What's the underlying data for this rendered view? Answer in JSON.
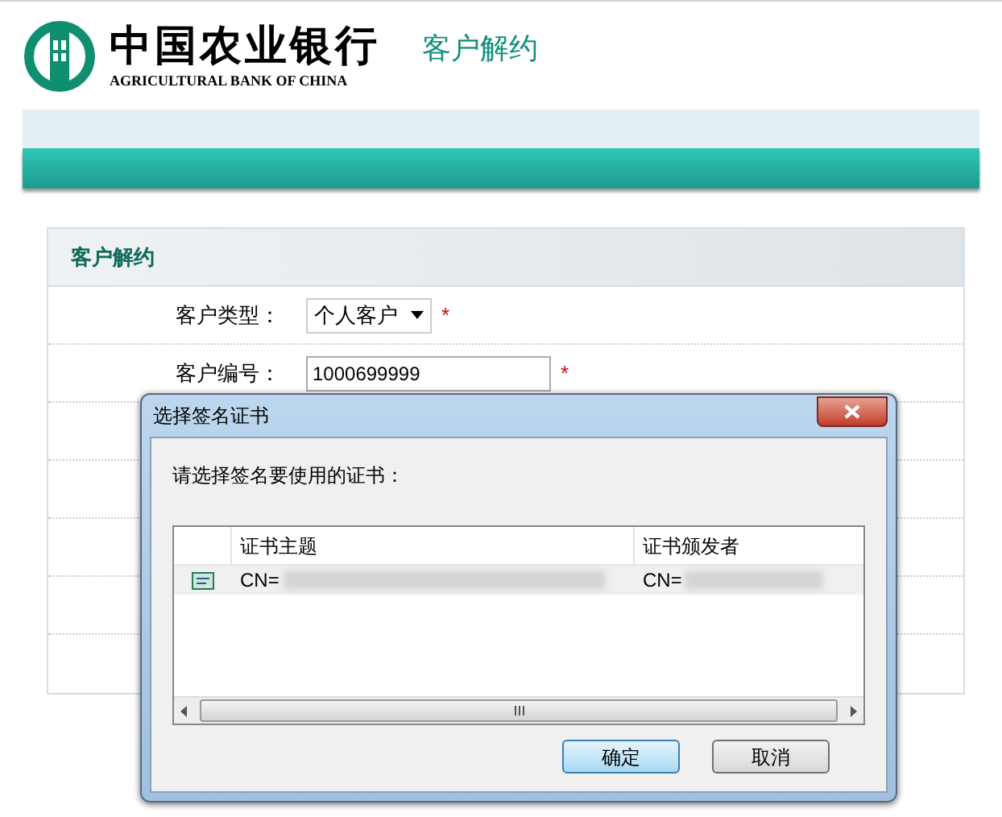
{
  "header": {
    "bank_name": "中国农业银行",
    "bank_name_en": "AGRICULTURAL BANK OF CHINA",
    "page_title": "客户解约"
  },
  "panel": {
    "title": "客户解约",
    "fields": [
      {
        "kind": "select",
        "label": "客户类型：",
        "value": "个人客户",
        "required": true
      },
      {
        "kind": "input",
        "label": "客户编号：",
        "value": "1000699999",
        "required": true
      }
    ],
    "required_mark": "*"
  },
  "dialog": {
    "title": "选择签名证书",
    "prompt": "请选择签名要使用的证书：",
    "columns": [
      "证书主题",
      "证书颁发者"
    ],
    "rows": [
      {
        "subject": "CN=",
        "issuer": "CN=",
        "selected": true
      }
    ],
    "buttons": [
      {
        "label": "确定",
        "default": true
      },
      {
        "label": "取消",
        "default": false
      }
    ]
  }
}
